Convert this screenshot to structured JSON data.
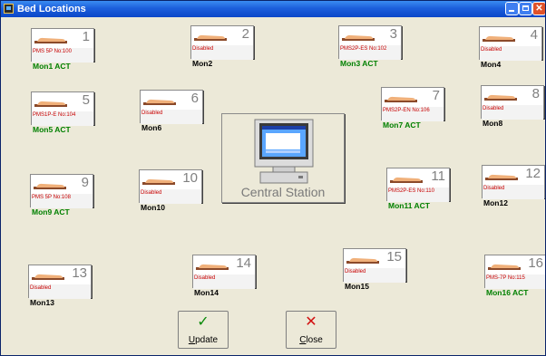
{
  "window": {
    "title": "Bed Locations"
  },
  "titlebar": {
    "minimize": "",
    "maximize": "",
    "close": "✕"
  },
  "beds": [
    {
      "number": "1",
      "sub": "PMS 5P No:100",
      "mon": "Mon1 ACT",
      "active": true
    },
    {
      "number": "2",
      "sub": "Disabled",
      "mon": "Mon2",
      "active": false
    },
    {
      "number": "3",
      "sub": "PMS2P-ES No:102",
      "mon": "Mon3 ACT",
      "active": true
    },
    {
      "number": "4",
      "sub": "Disabled",
      "mon": "Mon4",
      "active": false
    },
    {
      "number": "5",
      "sub": "PMS1P-E No:104",
      "mon": "Mon5 ACT",
      "active": true
    },
    {
      "number": "6",
      "sub": "Disabled",
      "mon": "Mon6",
      "active": false
    },
    {
      "number": "7",
      "sub": "PMS2P-EN No:106",
      "mon": "Mon7 ACT",
      "active": true
    },
    {
      "number": "8",
      "sub": "Disabled",
      "mon": "Mon8",
      "active": false
    },
    {
      "number": "9",
      "sub": "PMS 5P No:108",
      "mon": "Mon9 ACT",
      "active": true
    },
    {
      "number": "10",
      "sub": "Disabled",
      "mon": "Mon10",
      "active": false
    },
    {
      "number": "11",
      "sub": "PMS2P-ES No:110",
      "mon": "Mon11 ACT",
      "active": true
    },
    {
      "number": "12",
      "sub": "Disabled",
      "mon": "Mon12",
      "active": false
    },
    {
      "number": "13",
      "sub": "Disabled",
      "mon": "Mon13",
      "active": false
    },
    {
      "number": "14",
      "sub": "Disabled",
      "mon": "Mon14",
      "active": false
    },
    {
      "number": "15",
      "sub": "Disabled",
      "mon": "Mon15",
      "active": false
    },
    {
      "number": "16",
      "sub": "PMS-7P No:115",
      "mon": "Mon16 ACT",
      "active": true
    }
  ],
  "central": {
    "label": "Central Station",
    "icon": "computer-monitor-icon"
  },
  "actions": {
    "update": {
      "icon": "✓",
      "mnemonic": "U",
      "rest": "pdate"
    },
    "close": {
      "icon": "✕",
      "mnemonic": "C",
      "rest": "lose"
    }
  },
  "colors": {
    "active_text": "#008000",
    "sub_text": "#c80000",
    "title_bar": "#0b47c8"
  }
}
